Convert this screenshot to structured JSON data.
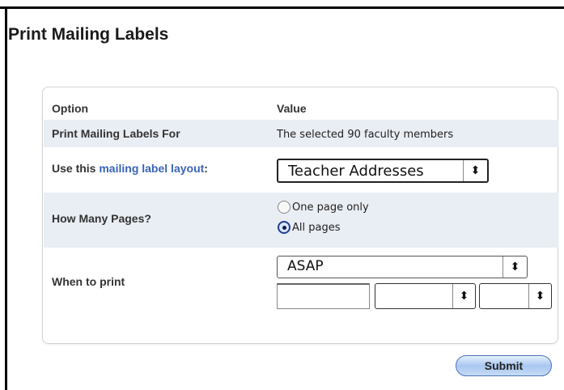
{
  "page": {
    "title": "Print Mailing Labels"
  },
  "table": {
    "header_option": "Option",
    "header_value": "Value",
    "rows": {
      "for_label": "Print Mailing Labels For",
      "for_value": "The selected 90 faculty members",
      "layout_label_prefix": "Use this ",
      "layout_label_link": "mailing label layout",
      "layout_label_suffix": ":",
      "layout_selected": "Teacher Addresses",
      "pages_label": "How Many Pages?",
      "pages_option_one": "One page only",
      "pages_option_all": "All pages",
      "pages_selected": "All pages",
      "when_label": "When to print",
      "when_selected": "ASAP",
      "date_value": "",
      "select_a_value": "",
      "select_b_value": ""
    }
  },
  "actions": {
    "submit_label": "Submit"
  },
  "icons": {
    "select_arrows": "up-down-arrows-icon",
    "radio": "radio-icon"
  },
  "colors": {
    "row_shade": "#e9edf4",
    "link": "#3a63b8",
    "button": "#a9c7f0"
  }
}
